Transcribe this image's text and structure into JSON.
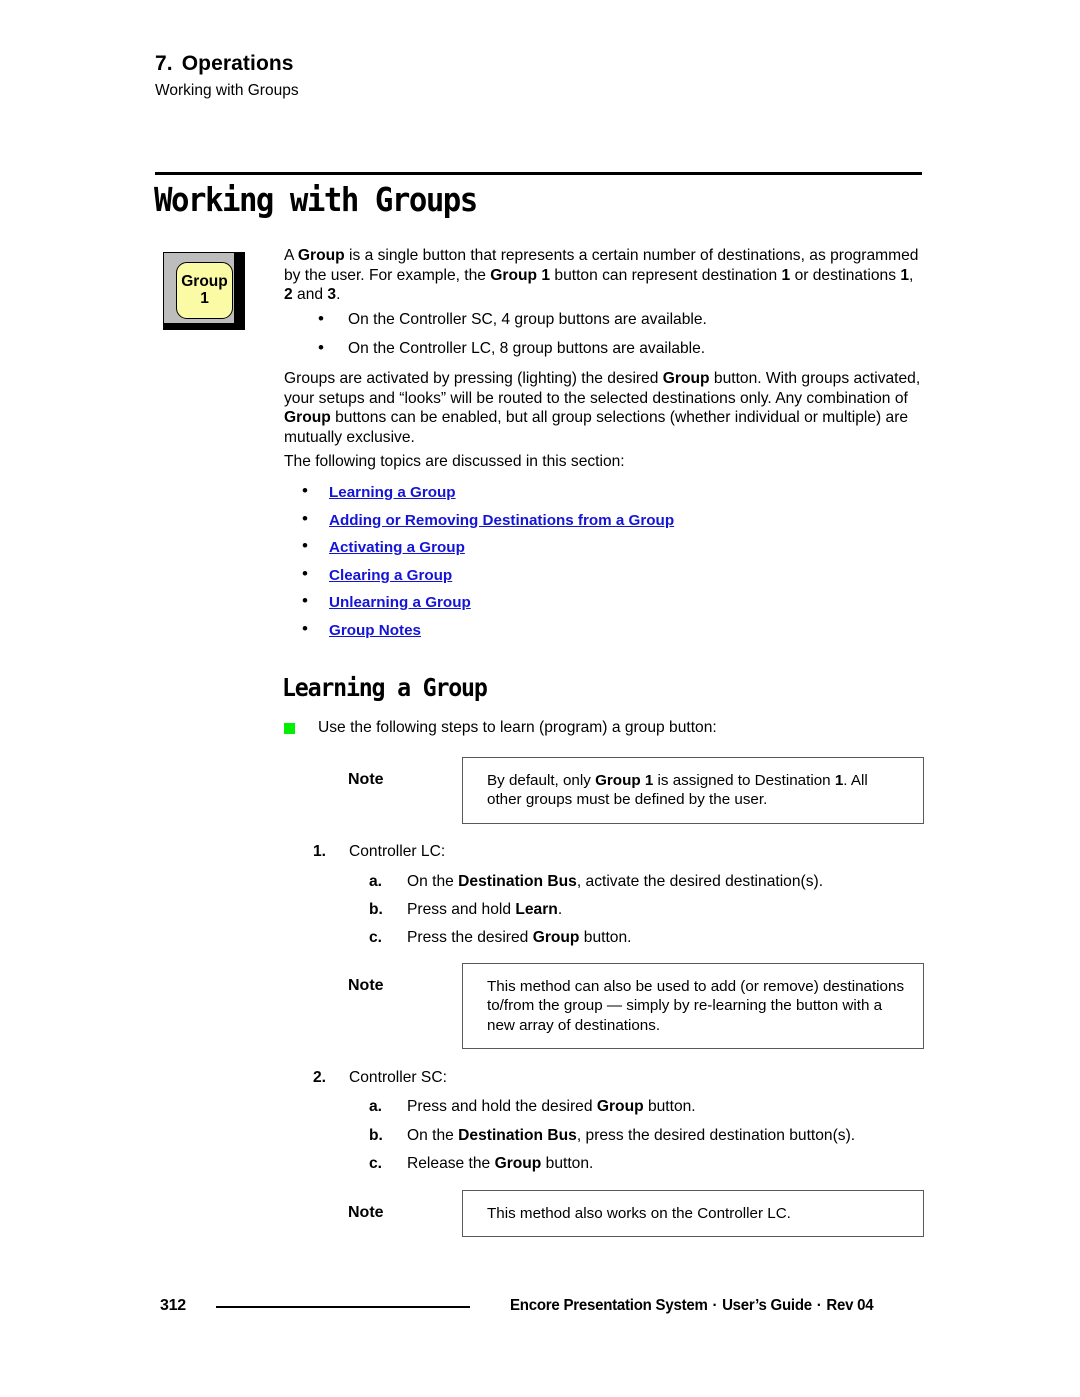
{
  "header": {
    "chapter_number": "7.",
    "chapter_title": "Operations",
    "subtitle": "Working with Groups"
  },
  "main_heading": "Working with Groups",
  "group_button": {
    "line1": "Group",
    "line2": "1",
    "cap_color": "#FBFBA6",
    "bevel_color": "#BDBDBD",
    "shadow_color": "#000000"
  },
  "intro": {
    "paragraph_1_html": "A <b>Group</b> is a single button that represents a certain number of destinations, as programmed by the user.  For example, the <b>Group 1</b> button can represent destination <b>1</b> or destinations <b>1</b>, <b>2</b> and <b>3</b>.",
    "bullets": [
      "On the Controller SC, 4 group buttons are available.",
      "On the Controller LC, 8 group buttons are available."
    ],
    "paragraph_2": "Groups are activated by pressing (lighting) the desired Group button.  With groups activated, your setups and “looks” will be routed to the selected destinations only.  Any combination of Group buttons can be enabled, but all group selections (whether individual or multiple) are mutually exclusive.",
    "paragraph_2_html": "Groups are activated by pressing (lighting) the desired <b>Group</b> button.  With groups activated, your setups and &ldquo;looks&rdquo; will be routed to the selected destinations only.  Any combination of <b>Group</b> buttons can be enabled, but all group selections (whether individual or multiple) are mutually exclusive.",
    "topics_intro": "The following topics are discussed in this section:"
  },
  "topic_links": [
    "Learning a Group",
    "Adding or Removing Destinations from a Group",
    "Activating a Group",
    "Clearing a Group",
    "Unlearning a Group",
    "Group Notes"
  ],
  "link_color": "#1414D6",
  "section": {
    "heading": "Learning a Group",
    "lead_in": "Use the following steps to learn (program) a group button:",
    "bullet_color": "#00F000"
  },
  "notes": [
    {
      "label": "Note",
      "text_html": "By default, only <b>Group 1</b> is assigned to Destination <b>1</b>.  All other groups must be defined by the user."
    },
    {
      "label": "Note",
      "text_html": "This method can also be used to add (or remove) destinations to/from the group &mdash; simply by re-learning the button with a new array of destinations."
    },
    {
      "label": "Note",
      "text_html": "This method also works on the Controller LC."
    }
  ],
  "steps": [
    {
      "number": "1.",
      "title": "Controller LC:",
      "substeps": [
        {
          "letter": "a.",
          "text_html": "On the <b>Destination Bus</b>, activate the desired destination(s)."
        },
        {
          "letter": "b.",
          "text_html": "Press and hold <b>Learn</b>."
        },
        {
          "letter": "c.",
          "text_html": "Press the desired <b>Group</b> button."
        }
      ]
    },
    {
      "number": "2.",
      "title": "Controller SC:",
      "substeps": [
        {
          "letter": "a.",
          "text_html": "Press and hold the desired <b>Group</b> button."
        },
        {
          "letter": "b.",
          "text_html": "On the <b>Destination Bus</b>, press the desired destination button(s)."
        },
        {
          "letter": "c.",
          "text_html": "Release the <b>Group</b> button."
        }
      ]
    }
  ],
  "footer": {
    "page_number": "312",
    "product": "Encore Presentation System",
    "doc_type": "User’s Guide",
    "revision": "Rev 04",
    "separator": "·"
  }
}
